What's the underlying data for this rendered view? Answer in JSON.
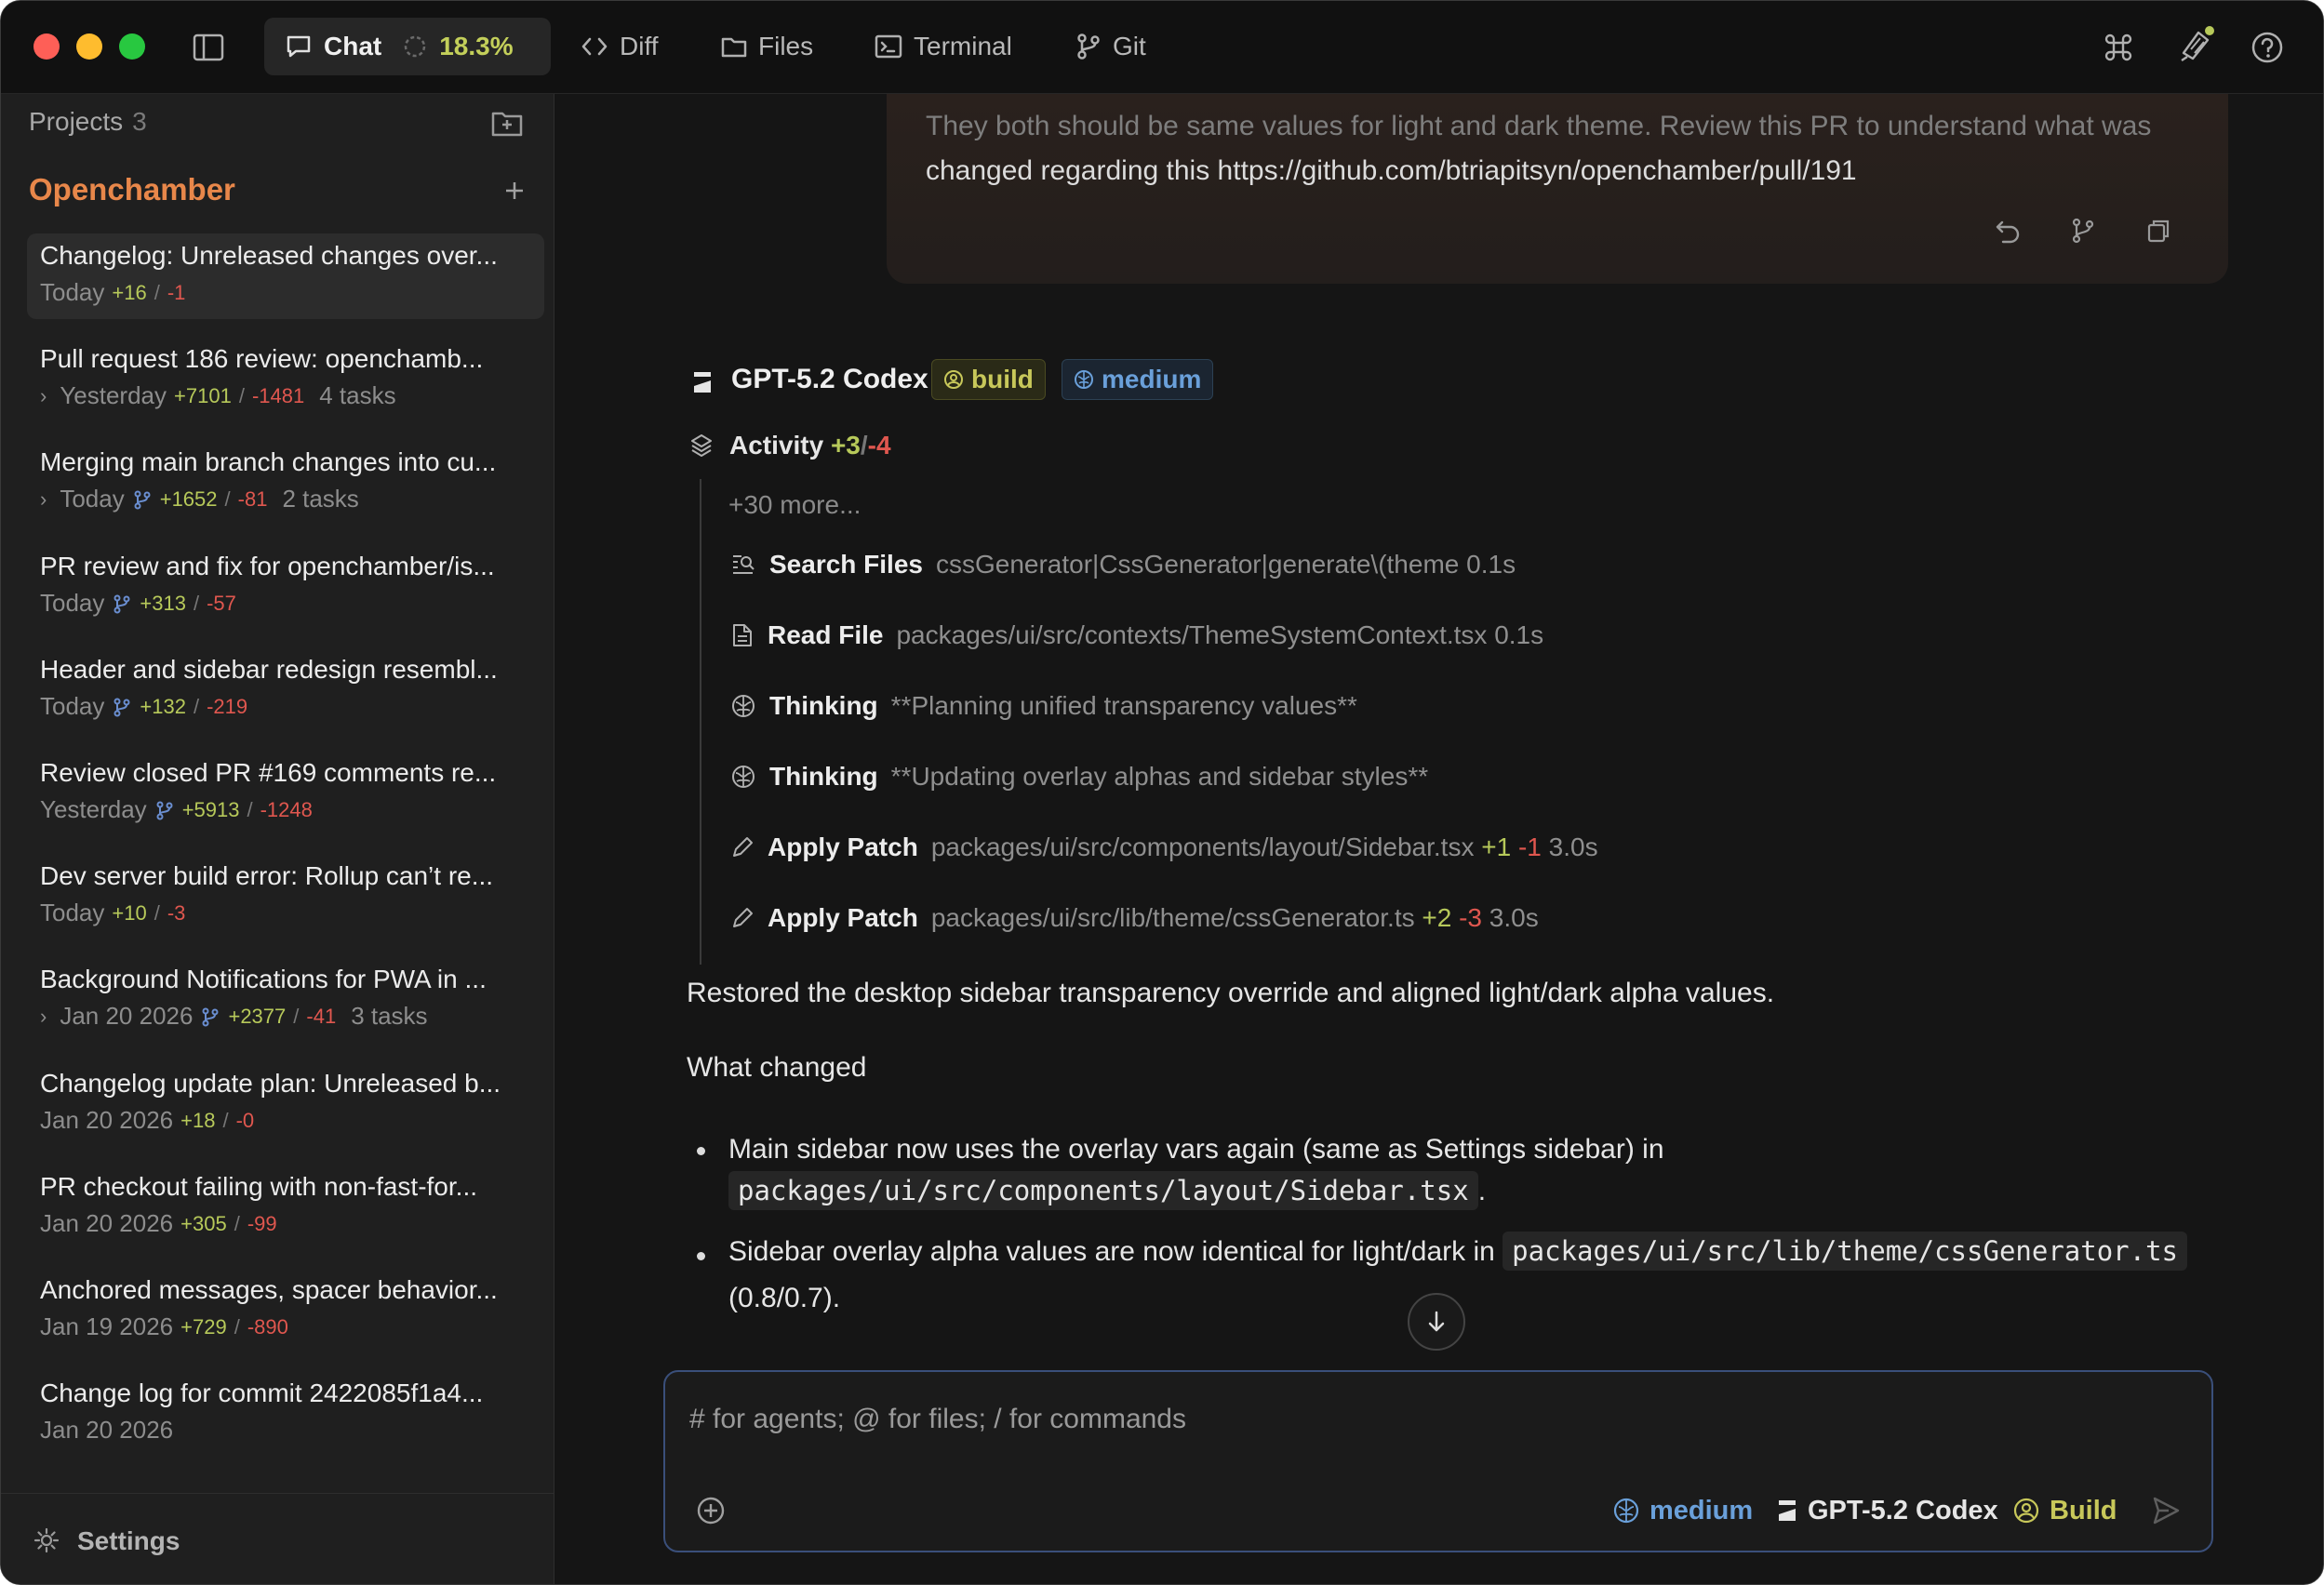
{
  "topbar": {
    "tabs": [
      {
        "label": "Chat",
        "icon": "chat-icon"
      },
      {
        "label": "Diff",
        "icon": "code-icon"
      },
      {
        "label": "Files",
        "icon": "folder-icon"
      },
      {
        "label": "Terminal",
        "icon": "terminal-icon"
      },
      {
        "label": "Git",
        "icon": "git-branch-icon"
      }
    ],
    "chat_progress": "18.3%",
    "right_icons": [
      "command-icon",
      "notification-icon",
      "help-icon"
    ]
  },
  "sidebar": {
    "projects_label": "Projects",
    "projects_count": "3",
    "project_name": "Openchamber",
    "sessions": [
      {
        "title": "Changelog: Unreleased changes over...",
        "date": "Today",
        "add": "+16",
        "del": "-1",
        "tasks": ""
      },
      {
        "title": "Pull request 186 review: openchamb...",
        "date": "Yesterday",
        "add": "+7101",
        "del": "-1481",
        "tasks": "4 tasks"
      },
      {
        "title": "Merging main branch changes into cu...",
        "date": "Today",
        "add": "+1652",
        "del": "-81",
        "tasks": "2 tasks"
      },
      {
        "title": "PR review and fix for openchamber/is...",
        "date": "Today",
        "add": "+313",
        "del": "-57",
        "tasks": ""
      },
      {
        "title": "Header and sidebar redesign resembl...",
        "date": "Today",
        "add": "+132",
        "del": "-219",
        "tasks": ""
      },
      {
        "title": "Review closed PR #169 comments re...",
        "date": "Yesterday",
        "add": "+5913",
        "del": "-1248",
        "tasks": ""
      },
      {
        "title": "Dev server build error: Rollup can’t re...",
        "date": "Today",
        "add": "+10",
        "del": "-3",
        "tasks": ""
      },
      {
        "title": "Background Notifications for PWA in ...",
        "date": "Jan 20 2026",
        "add": "+2377",
        "del": "-41",
        "tasks": "3 tasks"
      },
      {
        "title": "Changelog update plan: Unreleased b...",
        "date": "Jan 20 2026",
        "add": "+18",
        "del": "-0",
        "tasks": ""
      },
      {
        "title": "PR checkout failing with non-fast-for...",
        "date": "Jan 20 2026",
        "add": "+305",
        "del": "-99",
        "tasks": ""
      },
      {
        "title": "Anchored messages, spacer behavior...",
        "date": "Jan 19 2026",
        "add": "+729",
        "del": "-890",
        "tasks": ""
      },
      {
        "title": "Change log for commit 2422085f1a4...",
        "date": "Jan 20 2026",
        "add": "",
        "del": "",
        "tasks": ""
      }
    ],
    "settings_label": "Settings"
  },
  "chat": {
    "user_message": {
      "line1": "They both should be same values for light and dark theme. Review this PR to understand what was",
      "line2": "changed regarding this https://github.com/btriapitsyn/openchamber/pull/191"
    },
    "assistant": {
      "model": "GPT-5.2 Codex",
      "agent_badge": "build",
      "effort_badge": "medium",
      "activity_label": "Activity",
      "activity_add": "+3",
      "activity_del": "-4",
      "more_label": "+30 more...",
      "activity_items": [
        {
          "tool": "Search Files",
          "arg": "cssGenerator|CssGenerator|generate\\(theme",
          "time": "0.1s",
          "add": "",
          "del": "",
          "icon": "search-files-icon"
        },
        {
          "tool": "Read File",
          "arg": "packages/ui/src/contexts/ThemeSystemContext.tsx",
          "time": "0.1s",
          "add": "",
          "del": "",
          "icon": "file-icon"
        },
        {
          "tool": "Thinking",
          "arg": "**Planning unified transparency values**",
          "time": "",
          "add": "",
          "del": "",
          "icon": "brain-icon"
        },
        {
          "tool": "Thinking",
          "arg": "**Updating overlay alphas and sidebar styles**",
          "time": "",
          "add": "",
          "del": "",
          "icon": "brain-icon"
        },
        {
          "tool": "Apply Patch",
          "arg": "packages/ui/src/components/layout/Sidebar.tsx",
          "time": "3.0s",
          "add": "+1",
          "del": "-1",
          "icon": "pencil-icon"
        },
        {
          "tool": "Apply Patch",
          "arg": "packages/ui/src/lib/theme/cssGenerator.ts",
          "time": "3.0s",
          "add": "+2",
          "del": "-3",
          "icon": "pencil-icon"
        }
      ],
      "summary": "Restored the desktop sidebar transparency override and aligned light/dark alpha values.",
      "what_changed": "What changed",
      "bullet1_text": "Main sidebar now uses the overlay vars again (same as Settings sidebar) in",
      "bullet1_code": "packages/ui/src/components/layout/Sidebar.tsx",
      "bullet1_end": ".",
      "bullet2_text": "Sidebar overlay alpha values are now identical for light/dark in",
      "bullet2_code": "packages/ui/src/lib/theme/cssGenerator.ts",
      "bullet2_end": "(0.8/0.7)."
    }
  },
  "composer": {
    "placeholder": "# for agents; @ for files; / for commands",
    "effort": "medium",
    "model": "GPT-5.2 Codex",
    "agent": "Build"
  },
  "colors": {
    "accent_orange": "#e8874a",
    "add_green": "#b7c95a",
    "del_red": "#e0574f",
    "effort_blue": "#6aa0da",
    "build_yellow": "#c8c85a"
  }
}
